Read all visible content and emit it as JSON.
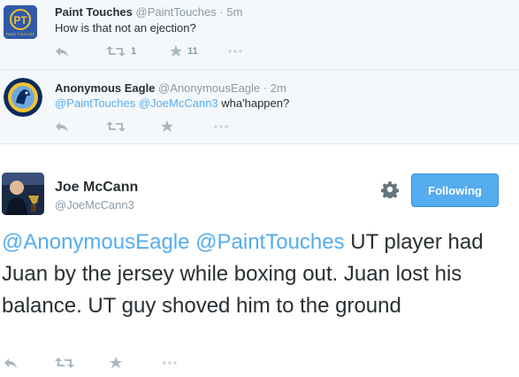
{
  "tweet1": {
    "name": "Paint Touches",
    "handle": "@PaintTouches",
    "sep": "·",
    "time": "5m",
    "text": "How is that not an ejection?",
    "retweets": "1",
    "favorites": "11",
    "avatar_text": "PT",
    "avatar_sub": "PAINT TOUCHES"
  },
  "tweet2": {
    "name": "Anonymous Eagle",
    "handle": "@AnonymousEagle",
    "sep": "·",
    "time": "2m",
    "mention1": "@PaintTouches",
    "mention2": "@JoeMcCann3",
    "rest": " wha'happen?"
  },
  "main": {
    "name": "Joe McCann",
    "handle": "@JoeMcCann3",
    "follow_label": "Following",
    "mention1": "@AnonymousEagle",
    "mention2": "@PaintTouches",
    "body": " UT player had Juan by the jersey while boxing out. Juan lost his balance. UT guy shoved him to the ground"
  },
  "colors": {
    "link": "#55acee",
    "button": "#55acee",
    "muted": "#8899a6"
  },
  "icons": [
    "reply-icon",
    "retweet-icon",
    "favorite-icon",
    "more-icon",
    "gear-icon"
  ]
}
